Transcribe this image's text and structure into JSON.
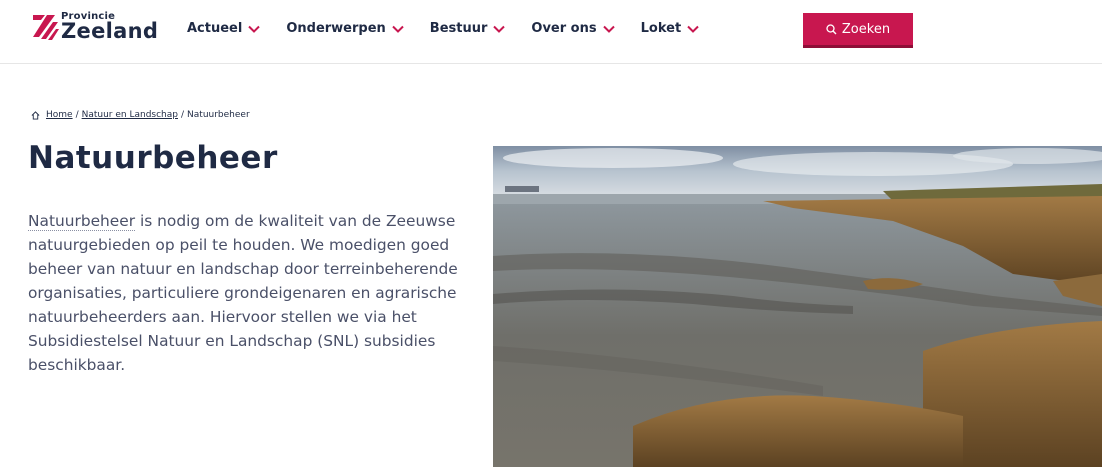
{
  "logo": {
    "small": "Provincie",
    "big": "Zeeland"
  },
  "nav": {
    "items": [
      {
        "label": "Actueel"
      },
      {
        "label": "Onderwerpen"
      },
      {
        "label": "Bestuur"
      },
      {
        "label": "Over ons"
      },
      {
        "label": "Loket"
      }
    ]
  },
  "search": {
    "label": "Zoeken"
  },
  "breadcrumb": {
    "home": "Home",
    "sep1": "/",
    "parent": "Natuur en Landschap",
    "sep2": "/",
    "current": "Natuurbeheer"
  },
  "page": {
    "title": "Natuurbeheer",
    "intro_link": "Natuurbeheer",
    "intro_text": " is nodig om de kwaliteit van de Zeeuwse natuurgebieden op peil te houden. We moedigen goed beheer van natuur en landschap door terreinbeherende organisaties, particuliere grondeigenaren en agrarische natuurbeheerders aan. Hiervoor stellen we via het Subsidiestelsel Natuur en Landschap (SNL) subsidies beschikbaar."
  },
  "colors": {
    "brand": "#c8174f",
    "navy": "#1f2a44",
    "text": "#4a5068"
  }
}
